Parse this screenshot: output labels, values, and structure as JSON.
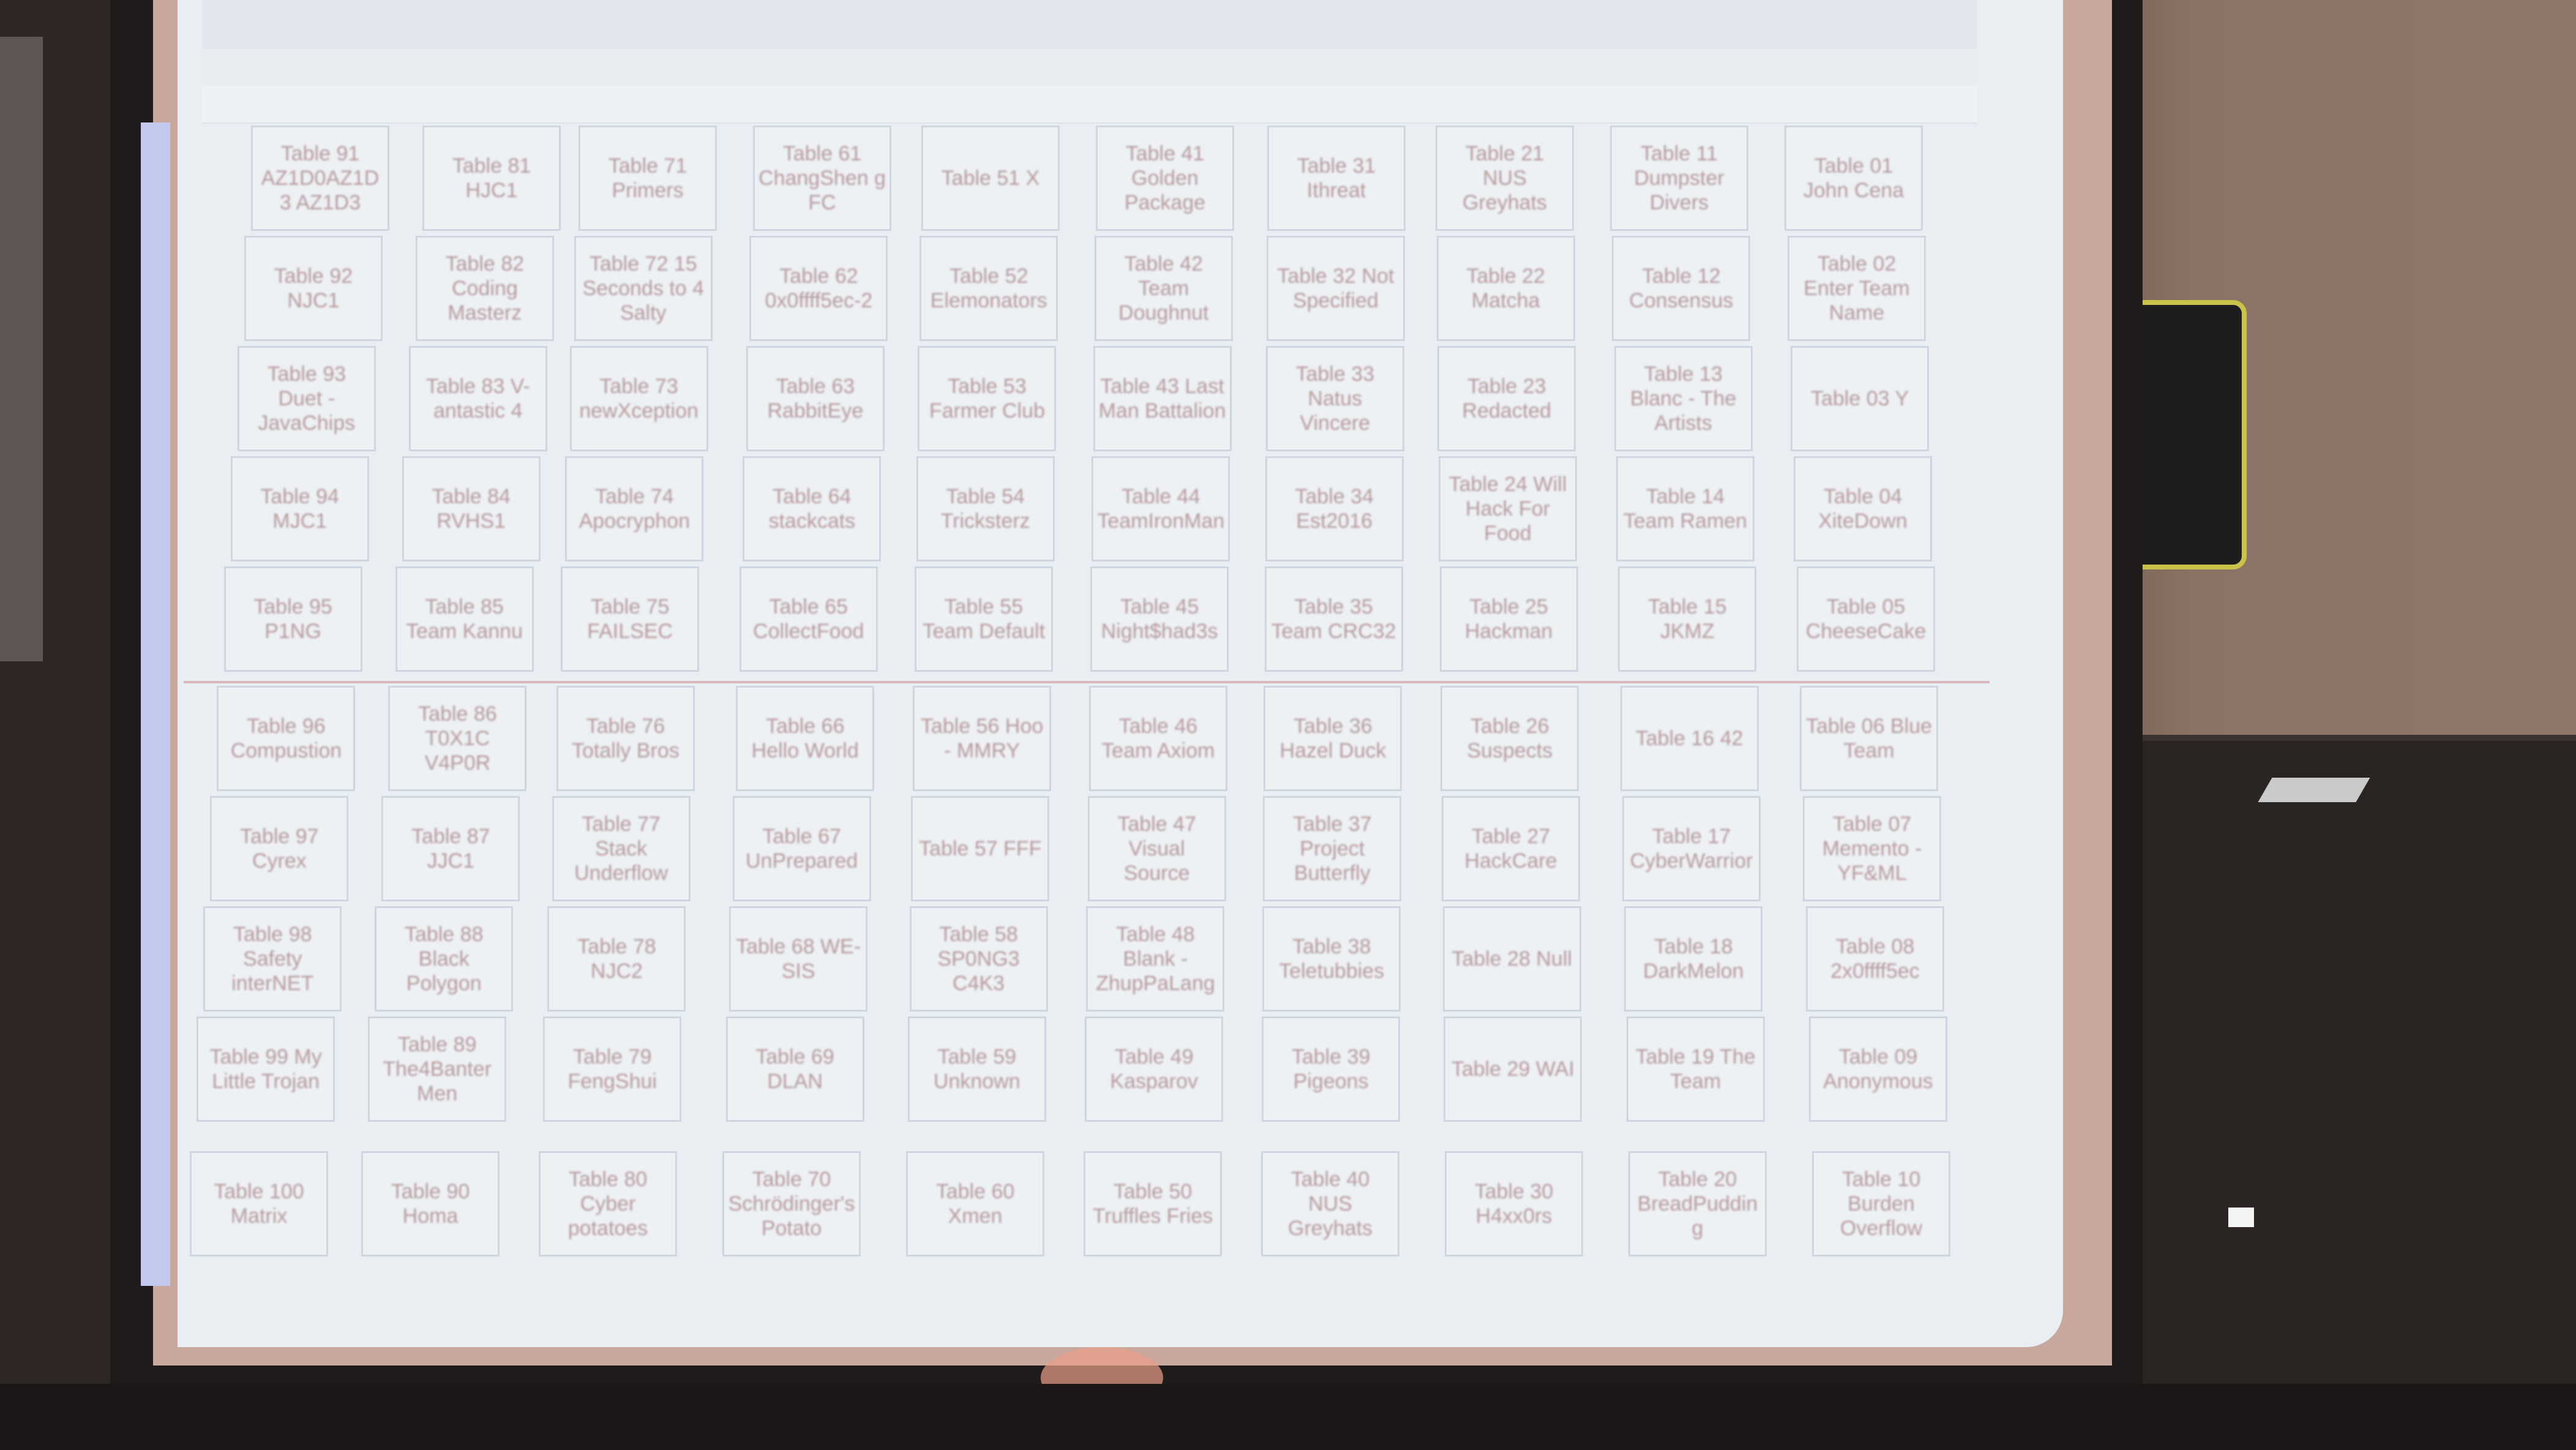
{
  "spreadsheet": {
    "tables": [
      [
        "Table 91 AZ1D0AZ1D3 AZ1D3",
        "Table 81 HJC1",
        "Table 71 Primers",
        "Table 61 ChangShen g FC",
        "Table 51 X",
        "Table 41 Golden Package",
        "Table 31 Ithreat",
        "Table 21 NUS Greyhats",
        "Table 11 Dumpster Divers",
        "Table 01 John Cena"
      ],
      [
        "Table 92 NJC1",
        "Table 82 Coding Masterz",
        "Table 72 15 Seconds to 4 Salty",
        "Table 62 0x0ffff5ec-2",
        "Table 52 Elemonators",
        "Table 42 Team Doughnut",
        "Table 32 Not Specified",
        "Table 22 Matcha",
        "Table 12 Consensus",
        "Table 02 Enter Team Name"
      ],
      [
        "Table 93 Duet - JavaChips",
        "Table 83 V-antastic 4",
        "Table 73 newXception",
        "Table 63 RabbitEye",
        "Table 53 Farmer Club",
        "Table 43 Last Man Battalion",
        "Table 33 Natus Vincere",
        "Table 23 Redacted",
        "Table 13 Blanc - The Artists",
        "Table 03 Y"
      ],
      [
        "Table 94 MJC1",
        "Table 84 RVHS1",
        "Table 74 Apocryphon",
        "Table 64 stackcats",
        "Table 54 Tricksterz",
        "Table 44 TeamIronMan",
        "Table 34 Est2016",
        "Table 24 Will Hack For Food",
        "Table 14 Team Ramen",
        "Table 04 XiteDown"
      ],
      [
        "Table 95 P1NG",
        "Table 85 Team Kannu",
        "Table 75 FAILSEC",
        "Table 65 CollectFood",
        "Table 55 Team Default",
        "Table 45 Night$had3s",
        "Table 35 Team CRC32",
        "Table 25 Hackman",
        "Table 15 JKMZ",
        "Table 05 CheeseCake"
      ],
      [
        "Table 96 Compustion",
        "Table 86 T0X1C V4P0R",
        "Table 76 Totally Bros",
        "Table 66 Hello World",
        "Table 56 Hoo - MMRY",
        "Table 46 Team Axiom",
        "Table 36 Hazel Duck",
        "Table 26 Suspects",
        "Table 16 42",
        "Table 06 Blue Team"
      ],
      [
        "Table 97 Cyrex",
        "Table 87 JJC1",
        "Table 77 Stack Underflow",
        "Table 67 UnPrepared",
        "Table 57 FFF",
        "Table 47 Visual Source",
        "Table 37 Project Butterfly",
        "Table 27 HackCare",
        "Table 17 CyberWarrior",
        "Table 07 Memento - YF&ML"
      ],
      [
        "Table 98 Safety interNET",
        "Table 88 Black Polygon",
        "Table 78 NJC2",
        "Table 68 WE-SIS",
        "Table 58 SP0NG3 C4K3",
        "Table 48 Blank - ZhupPaLang",
        "Table 38 Teletubbies",
        "Table 28 Null",
        "Table 18 DarkMelon",
        "Table 08 2x0ffff5ec"
      ],
      [
        "Table 99 My Little Trojan",
        "Table 89 The4Banter Men",
        "Table 79 FengShui",
        "Table 69 DLAN",
        "Table 59 Unknown",
        "Table 49 Kasparov",
        "Table 39 Pigeons",
        "Table 29 WAI",
        "Table 19 The Team",
        "Table 09 Anonymous"
      ],
      [
        "Table 100 Matrix",
        "Table 90 Homa",
        "Table 80 Cyber potatoes",
        "Table 70 Schrödinger's Potato",
        "Table 60 Xmen",
        "Table 50 Truffles Fries",
        "Table 40 NUS Greyhats",
        "Table 30 H4xx0rs",
        "Table 20 BreadPudding",
        "Table 10 Burden Overflow"
      ]
    ]
  },
  "colors": {
    "cell_text": "#b79a9e",
    "projection_bg": "#e9eef2",
    "side_bar": "#c3c9ee"
  }
}
